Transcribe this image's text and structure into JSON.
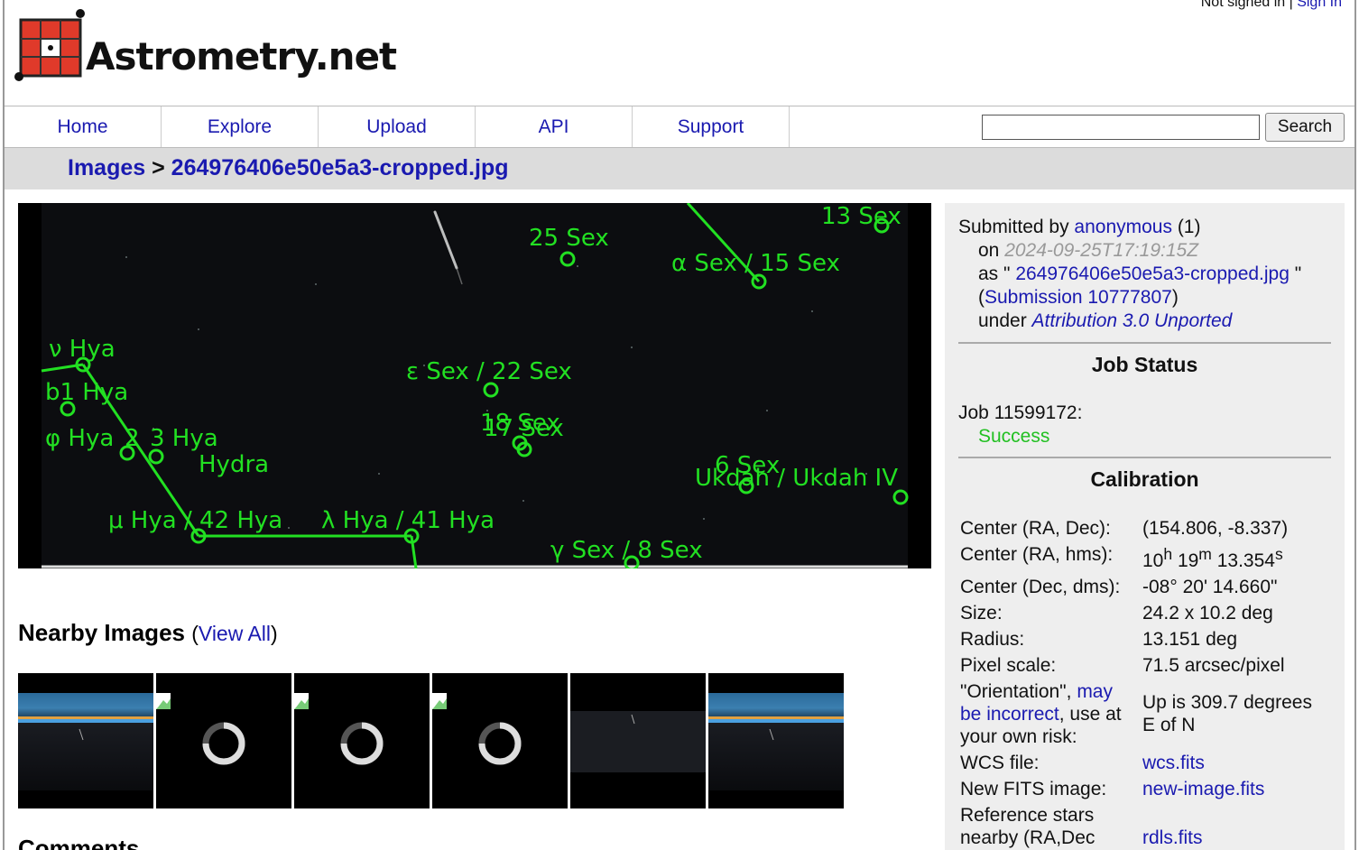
{
  "header": {
    "logo_text": "Astrometry.net",
    "auth_status": "Not signed in",
    "auth_sep": " | ",
    "sign_in": "Sign In"
  },
  "nav": {
    "items": [
      "Home",
      "Explore",
      "Upload",
      "API",
      "Support"
    ],
    "search_value": "",
    "search_button": "Search"
  },
  "breadcrumb": {
    "root": "Images",
    "sep": " > ",
    "current": "264976406e50e5a3-cropped.jpg"
  },
  "annotations": {
    "labels": [
      "13 Sex",
      "25 Sex",
      "α Sex / 15 Sex",
      "ν Hya",
      "b1 Hya",
      "ε Sex / 22 Sex",
      "18 Sex",
      "17 Sex",
      "φ Hya",
      "2",
      "3 Hya",
      "Hydra",
      "6 Sex",
      "Ukdah / Ukdah IV",
      "μ Hya / 42 Hya",
      "λ Hya / 41 Hya",
      "γ Sex / 8 Sex"
    ],
    "color": "#22e022"
  },
  "nearby": {
    "title": "Nearby Images",
    "view_all": "View All",
    "open_paren": "(",
    "close_paren": ")"
  },
  "comments": {
    "title": "Comments"
  },
  "submission": {
    "submitted_by_label": "Submitted by ",
    "user": "anonymous",
    "user_count": " (1)",
    "on_label": "on ",
    "date": "2024-09-25T17:19:15Z",
    "as_label": "as \" ",
    "filename": "264976406e50e5a3-cropped.jpg",
    "as_close": " \"",
    "submission_link": "Submission 10777807",
    "under_label": "under ",
    "license": "Attribution 3.0 Unported"
  },
  "job": {
    "title": "Job Status",
    "job_label": "Job 11599172:",
    "status": "Success"
  },
  "calibration": {
    "title": "Calibration",
    "center_radec_label": "Center (RA, Dec):",
    "center_radec": "(154.806, -8.337)",
    "center_hms_label": "Center (RA, hms):",
    "center_hms": {
      "h": "10",
      "m": "19",
      "s": "13.354"
    },
    "center_dms_label": "Center (Dec, dms):",
    "center_dms": "-08° 20' 14.660\"",
    "size_label": "Size:",
    "size": "24.2 x 10.2 deg",
    "radius_label": "Radius:",
    "radius": "13.151 deg",
    "pixel_scale_label": "Pixel scale:",
    "pixel_scale": "71.5 arcsec/pixel",
    "orientation_prefix": "\"Orientation\", ",
    "orientation_link": "may be incorrect",
    "orientation_suffix": ", use at your own risk:",
    "orientation": "Up is 309.7 degrees E of N",
    "wcs_label": "WCS file:",
    "wcs": "wcs.fits",
    "newfits_label": "New FITS image:",
    "newfits": "new-image.fits",
    "refstars_label": "Reference stars nearby (RA,Dec",
    "refstars": "rdls.fits"
  }
}
